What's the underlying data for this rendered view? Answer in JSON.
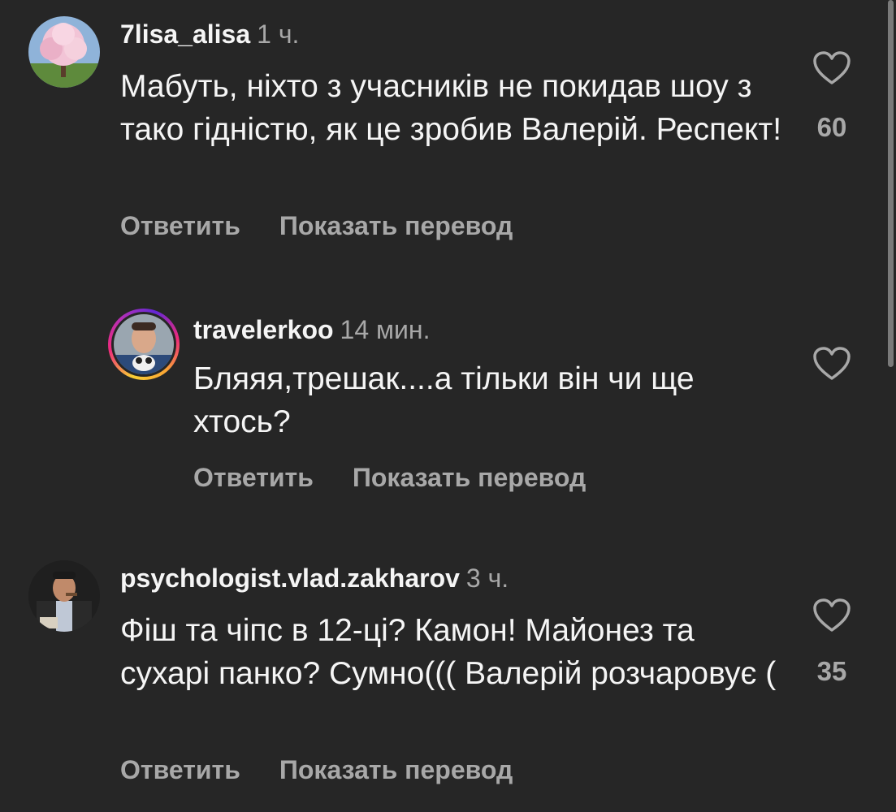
{
  "comments": [
    {
      "username": "7lisa_alisa",
      "time": "1 ч.",
      "text": "Мабуть, ніхто з учасників не покидав шоу з тако гідністю, як це зробив Валерій. Респект!",
      "likes": "60",
      "reply_label": "Ответить",
      "translate_label": "Показать перевод",
      "avatar_icon": "cherry-blossom-tree-photo"
    },
    {
      "username": "travelerkoo",
      "time": "14 мин.",
      "text": "Бляяя,трешак....а тільки він чи ще хтось?",
      "likes": "",
      "reply_label": "Ответить",
      "translate_label": "Показать перевод",
      "avatar_icon": "man-with-cat-photo",
      "has_story": true
    },
    {
      "username": "psychologist.vlad.zakharov",
      "time": "3 ч.",
      "text": "Фіш та чіпс в 12-ці? Камон! Майонез та сухарі панко? Сумно((( Валерій розчаровує (",
      "likes": "35",
      "reply_label": "Ответить",
      "translate_label": "Показать перевод",
      "avatar_icon": "man-portrait-photo"
    }
  ],
  "colors": {
    "background": "#262626",
    "primary_text": "#f5f5f5",
    "secondary_text": "#a8a8a8",
    "story_ring": [
      "#f9ce34",
      "#ee2a7b",
      "#6228d7"
    ]
  }
}
